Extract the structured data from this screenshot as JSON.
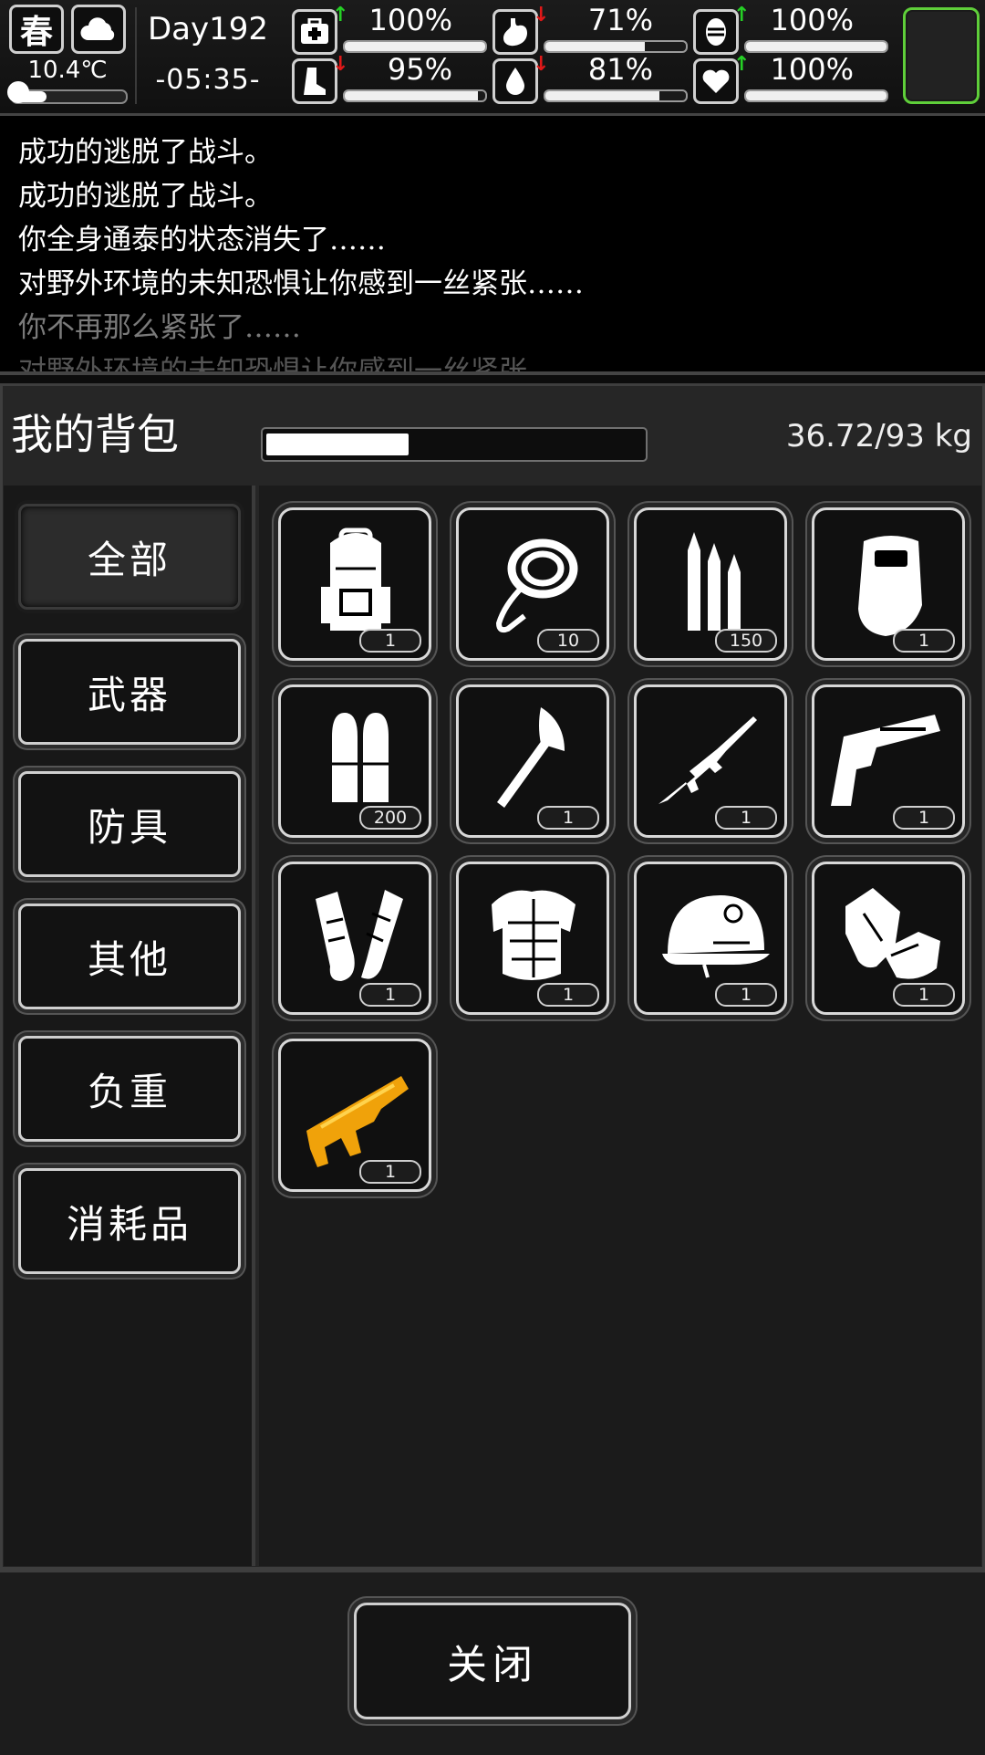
{
  "status": {
    "season": "春",
    "weather_icon": "cloud-icon",
    "temperature": "10.4℃",
    "temperature_level": 0.3,
    "day": "Day192",
    "time": "-05:35-",
    "stats": [
      {
        "name": "health",
        "icon": "medkit-icon",
        "trend": "up",
        "value": "100%",
        "fill": 1.0
      },
      {
        "name": "hunger",
        "icon": "stomach-icon",
        "trend": "down",
        "value": "71%",
        "fill": 0.71
      },
      {
        "name": "mind",
        "icon": "brain-icon",
        "trend": "up",
        "value": "100%",
        "fill": 1.0
      },
      {
        "name": "stamina",
        "icon": "boot-icon",
        "trend": "down",
        "value": "95%",
        "fill": 0.95
      },
      {
        "name": "thirst",
        "icon": "water-drop-icon",
        "trend": "down",
        "value": "81%",
        "fill": 0.81
      },
      {
        "name": "mood",
        "icon": "heart-icon",
        "trend": "up",
        "value": "100%",
        "fill": 1.0
      }
    ],
    "trend_colors": {
      "up": "#25d025",
      "down": "#e01818"
    },
    "portrait_border_color": "#5fcf3a"
  },
  "log": [
    {
      "text": "成功的逃脱了战斗。",
      "color": "#ffffff"
    },
    {
      "text": "成功的逃脱了战斗。",
      "color": "#ffffff"
    },
    {
      "text": "你全身通泰的状态消失了……",
      "color": "#ffffff"
    },
    {
      "text": "对野外环境的未知恐惧让你感到一丝紧张……",
      "color": "#ffffff"
    },
    {
      "text": "你不再那么紧张了……",
      "color": "#7a7a7a"
    },
    {
      "text": "对野外环境的未知恐惧让你感到一丝紧张……",
      "color": "#555555"
    }
  ],
  "backpack": {
    "title": "我的背包",
    "weight": "36.72/93 kg",
    "load_fraction": 0.39
  },
  "categories": [
    {
      "label": "全部",
      "active": true
    },
    {
      "label": "武器",
      "active": false
    },
    {
      "label": "防具",
      "active": false
    },
    {
      "label": "其他",
      "active": false
    },
    {
      "label": "负重",
      "active": false
    },
    {
      "label": "消耗品",
      "active": false
    }
  ],
  "items": [
    {
      "icon": "backpack-icon",
      "qty": "1"
    },
    {
      "icon": "rope-icon",
      "qty": "10"
    },
    {
      "icon": "rifle-ammo-icon",
      "qty": "150"
    },
    {
      "icon": "riot-shield-icon",
      "qty": "1"
    },
    {
      "icon": "pistol-ammo-icon",
      "qty": "200"
    },
    {
      "icon": "axe-icon",
      "qty": "1"
    },
    {
      "icon": "assault-rifle-icon",
      "qty": "1"
    },
    {
      "icon": "pistol-icon",
      "qty": "1"
    },
    {
      "icon": "arm-guards-icon",
      "qty": "1"
    },
    {
      "icon": "body-armor-icon",
      "qty": "1"
    },
    {
      "icon": "helmet-icon",
      "qty": "1"
    },
    {
      "icon": "gloves-icon",
      "qty": "1"
    },
    {
      "icon": "golden-shotgun-icon",
      "qty": "1",
      "color": "#f0a20a"
    }
  ],
  "footer": {
    "close_label": "关闭"
  }
}
